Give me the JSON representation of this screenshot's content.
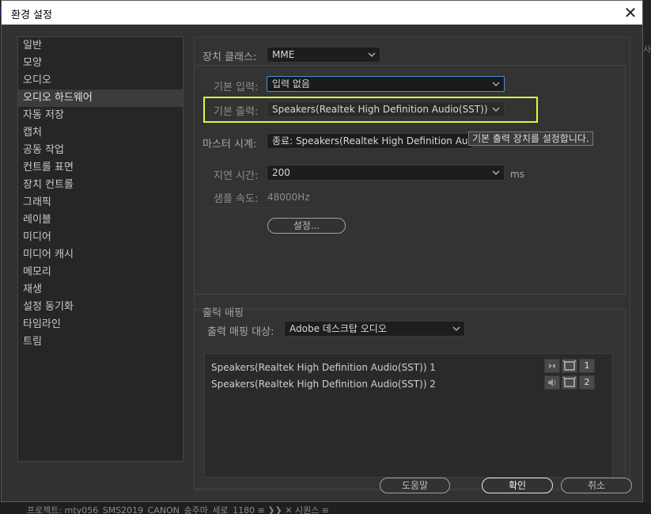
{
  "window": {
    "title": "환경 설정"
  },
  "background": {
    "right_text": "사",
    "bottom_text": "프로젝트: mty056_SMS2019_CANON_송주마_세로_1180    ≡    ❯❯   ✕  시퀀스  ≡"
  },
  "nav": {
    "items": [
      "일반",
      "모양",
      "오디오",
      "오디오 하드웨어",
      "자동 저장",
      "캡처",
      "공동 작업",
      "컨트롤 표면",
      "장치 컨트롤",
      "그래픽",
      "레이블",
      "미디어",
      "미디어 캐시",
      "메모리",
      "재생",
      "설정 동기화",
      "타임라인",
      "트림"
    ],
    "selected_index": 3
  },
  "device": {
    "class_label": "장치 클래스:",
    "class_value": "MME",
    "input_label": "기본 입력:",
    "input_value": "입력 없음",
    "output_label": "기본 출력:",
    "output_value": "Speakers(Realtek High Definition Audio(SST))",
    "master_clock_label": "마스터 시계:",
    "master_clock_value": "종료: Speakers(Realtek High Definition Audio",
    "tooltip": "기본 출력 장치를 설정합니다.",
    "latency_label": "지연 시간:",
    "latency_value": "200",
    "latency_unit": "ms",
    "sample_rate_label": "샘플 속도:",
    "sample_rate_value": "48000Hz",
    "settings_button": "설정..."
  },
  "output_mapping": {
    "section_label": "출력 매핑",
    "target_label": "출력 매핑 대상:",
    "target_value": "Adobe 데스크탑 오디오",
    "rows": [
      {
        "name": "Speakers(Realtek High Definition Audio(SST)) 1",
        "channel": "1"
      },
      {
        "name": "Speakers(Realtek High Definition Audio(SST)) 2",
        "channel": "2"
      }
    ]
  },
  "buttons": {
    "help": "도움말",
    "ok": "확인",
    "cancel": "취소"
  },
  "colors": {
    "highlight": "#e3f53a",
    "focus": "#4a8fd9"
  }
}
